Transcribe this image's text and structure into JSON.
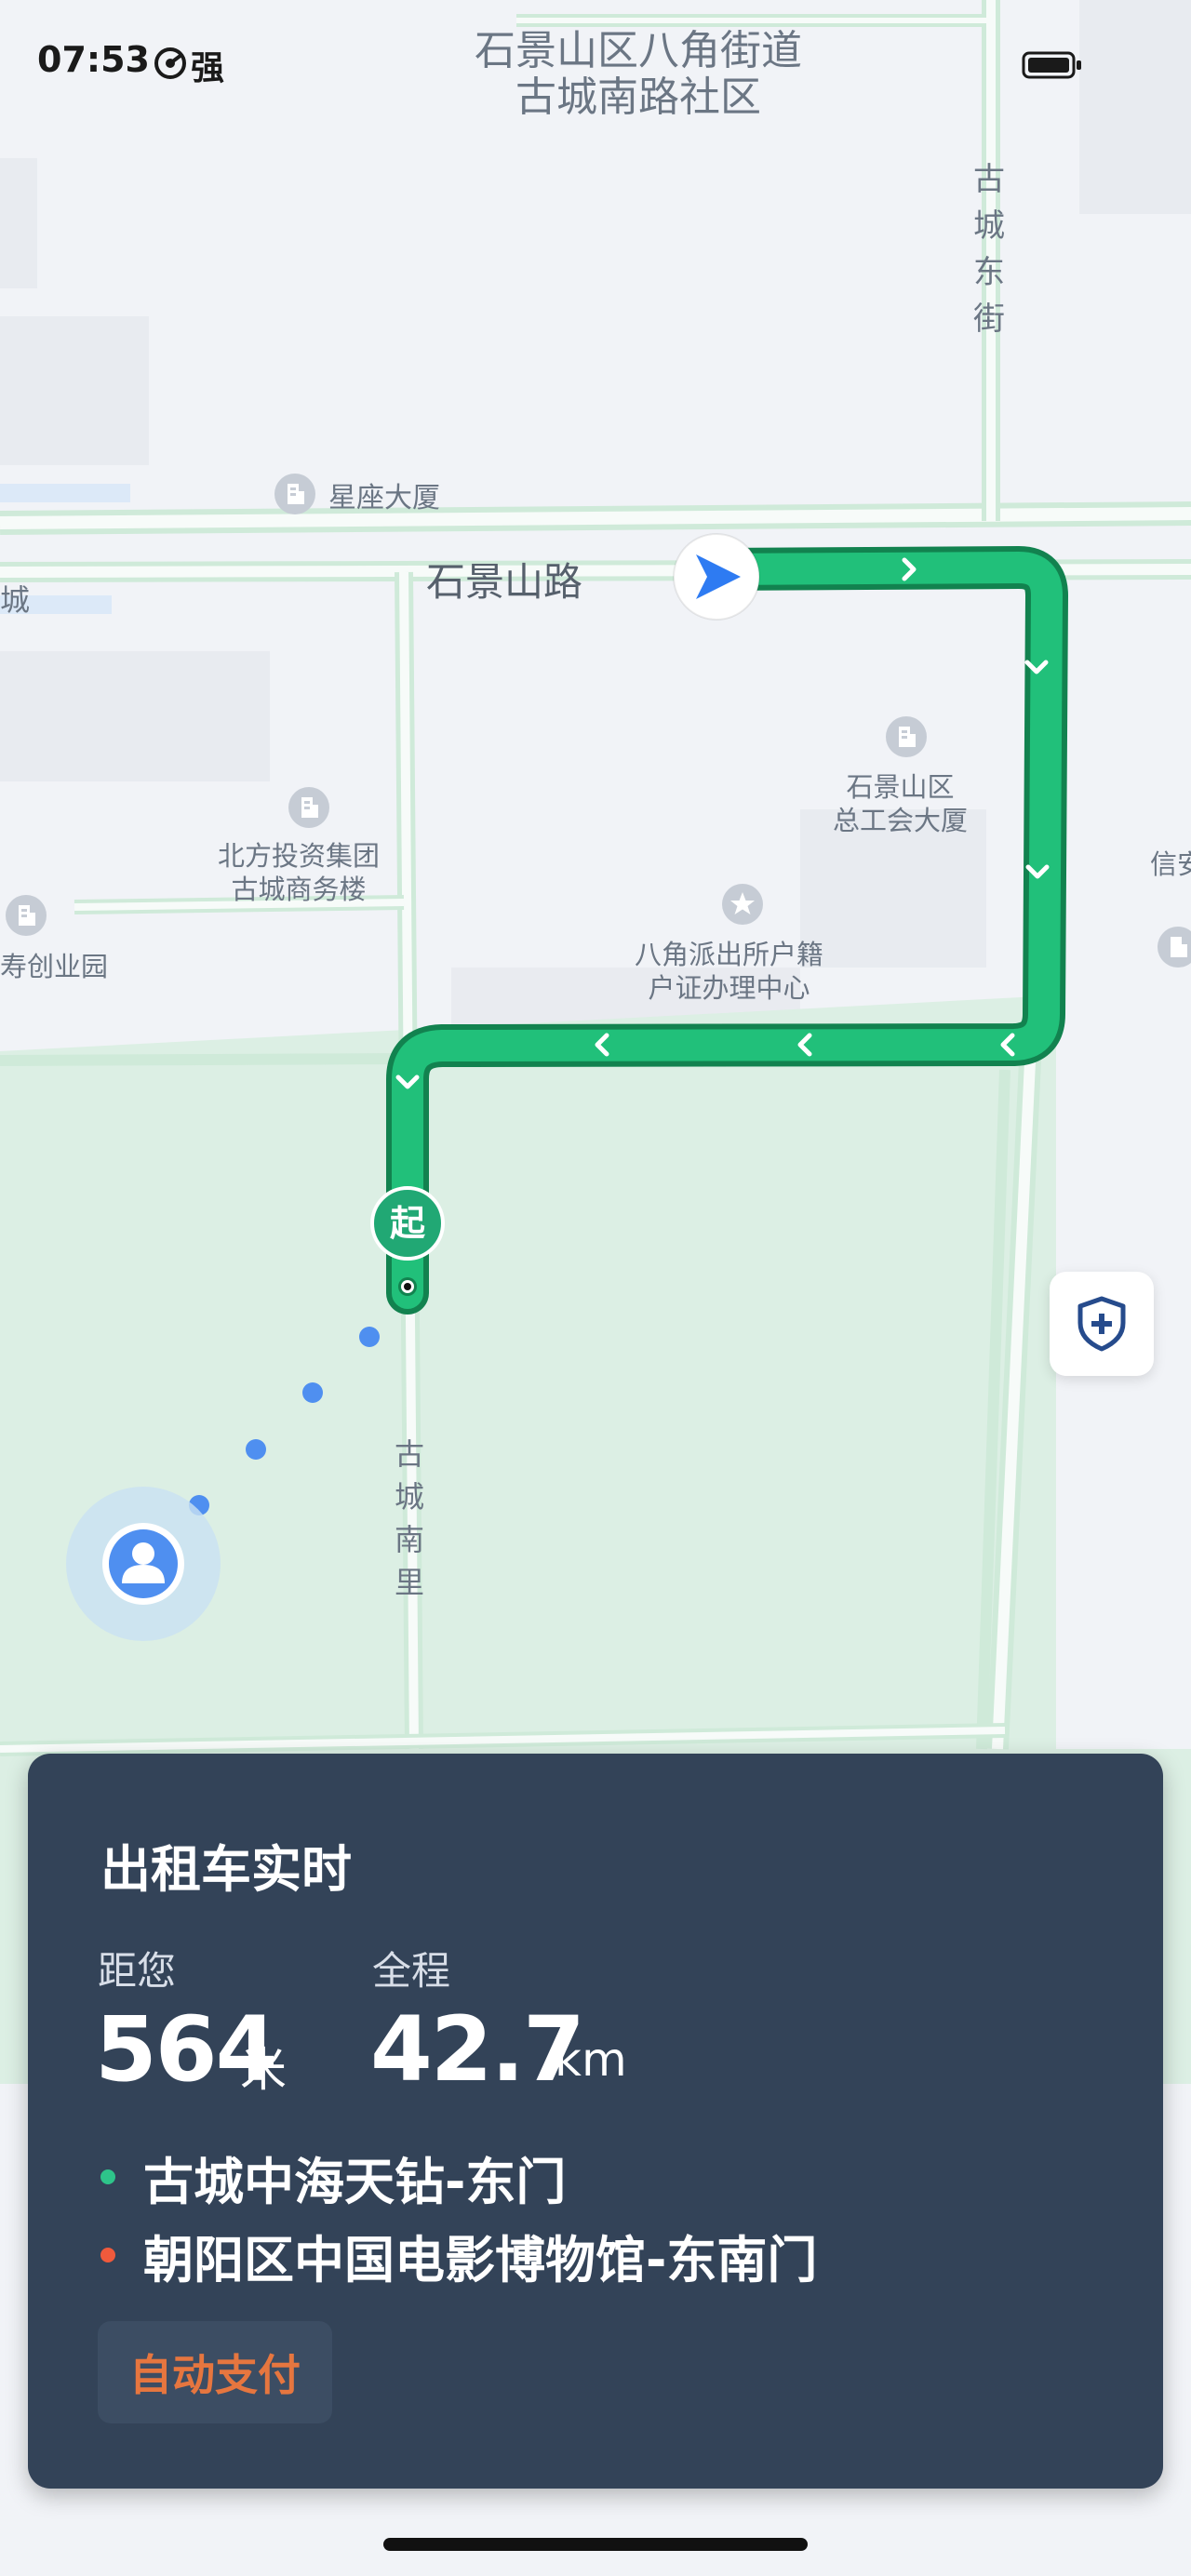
{
  "status_bar": {
    "time": "07:53",
    "signal_label": "强"
  },
  "map": {
    "labels": {
      "district_line1": "石景山区八角街道",
      "district_line2": "古城南路社区",
      "gucheng_east_street": "古城东街",
      "xingzuo_building": "星座大厦",
      "shijingshan_road": "石景山路",
      "left_edge_city": "城",
      "beifang_line1": "北方投资集团",
      "beifang_line2": "古城商务楼",
      "union_line1": "石景山区",
      "union_line2": "总工会大厦",
      "police_line1": "八角派出所户籍",
      "police_line2": "户证办理中心",
      "xin_an": "信安",
      "chuangye_park": "寿创业园",
      "gucheng_nanli": "古城南里"
    },
    "start_marker": "起",
    "colors": {
      "route": "#21c07a",
      "route_outline": "#12824f",
      "park": "#dcefe4",
      "nav_arrow": "#2e7bf2",
      "walk_dots": "#4f8ff0"
    },
    "icons": {
      "navigation": "navigation-arrow-icon",
      "user": "user-location-icon",
      "shield": "safety-shield-icon"
    }
  },
  "card": {
    "title": "出租车实时",
    "distance_label": "距您",
    "distance_value": "564",
    "distance_unit": "米",
    "total_label": "全程",
    "total_value": "42.7",
    "total_unit": "km",
    "origin": "古城中海天钻-东门",
    "destination": "朝阳区中国电影博物馆-东南门",
    "pay_button": "自动支付",
    "colors": {
      "background": "#334358",
      "origin_dot": "#2ec48a",
      "destination_dot": "#f05a3c",
      "pay_text": "#e6763f"
    }
  }
}
